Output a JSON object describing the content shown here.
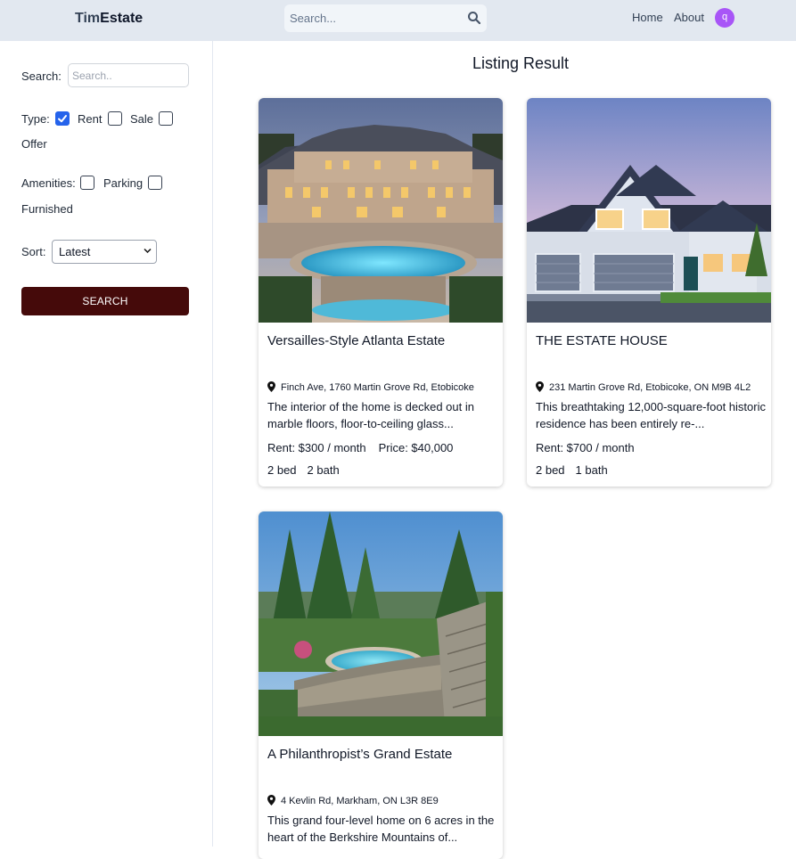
{
  "header": {
    "logo_part1": "Tim",
    "logo_part2": "Estate",
    "search_placeholder": "Search...",
    "nav_home": "Home",
    "nav_about": "About",
    "avatar_letter": "q",
    "avatar_color": "#a855f7"
  },
  "sidebar": {
    "search_label": "Search:",
    "search_placeholder": "Search..",
    "type_label": "Type:",
    "type_options": [
      {
        "label": "Rent",
        "checked": true
      },
      {
        "label": "Sale",
        "checked": false
      },
      {
        "label": "Offer",
        "checked": false
      }
    ],
    "amenities_label": "Amenities:",
    "amenity_options": [
      {
        "label": "Parking",
        "checked": false
      },
      {
        "label": "Furnished",
        "checked": false
      }
    ],
    "sort_label": "Sort:",
    "sort_selected": "Latest",
    "search_button": "SEARCH",
    "button_color": "#450a0a"
  },
  "main": {
    "title": "Listing Result",
    "listings": [
      {
        "title": "Versailles-Style Atlanta Estate",
        "address": "Finch Ave, 1760 Martin Grove Rd, Etobicoke",
        "description": "The interior of the home is decked out in marble floors, floor-to-ceiling glass...",
        "rent": "Rent: $300 / month",
        "price": "Price: $40,000",
        "beds": "2 bed",
        "baths": "2 bath",
        "image": "mansion-with-pool-photo"
      },
      {
        "title": "THE ESTATE HOUSE",
        "address": "231 Martin Grove Rd, Etobicoke, ON M9B 4L2",
        "description": "This breathtaking 12,000-square-foot historic residence has been entirely re-...",
        "rent": "Rent: $700 / month",
        "beds": "2 bed",
        "baths": "1 bath",
        "image": "suburban-house-photo"
      },
      {
        "title": "A Philanthropist’s Grand Estate",
        "address": "4 Kevlin Rd, Markham, ON L3R 8E9",
        "description": "This grand four-level home on 6 acres in the heart of the Berkshire Mountains of...",
        "image": "garden-pool-photo"
      }
    ]
  }
}
